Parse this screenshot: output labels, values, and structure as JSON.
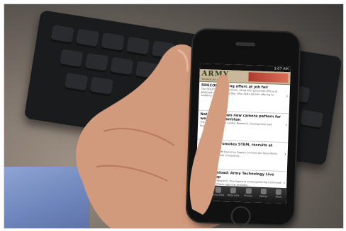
{
  "photo": {
    "subject": "hand holding smartphone over keyboard",
    "app_header": "ARMY",
    "app_subheader": "TECHNOLOGY LIVE",
    "status": {
      "carrier": "",
      "time": "3:07 AM"
    },
    "articles": [
      {
        "title": "RDECOM making offers at job fair",
        "summary": "The RDECOM recruiting team, along with personnel offices at RDECOM Headquarters Bay, Ohio State Job Fair offering to students and training..."
      },
      {
        "title": "Natick develops new camera pattern for wear in Afghanistan",
        "summary": "The U.S. Army Natick Soldier Research, Development and Engineering Center..."
      },
      {
        "title": "RDECOM promotes STEM, recruits at conference",
        "summary": "U.S. Army RDECOM Executive Deputy Commander Mary Martin addressed hundreds of students..."
      },
      {
        "title": "Free download: Army Technology Live iPhone app",
        "summary": "The U.S. Army Research, Development and Engineering Command has an official iPhone app now available..."
      }
    ],
    "tabs": [
      "News",
      "Army Jobs",
      "Webcasts",
      "Photos",
      "Twitter",
      "More"
    ]
  }
}
